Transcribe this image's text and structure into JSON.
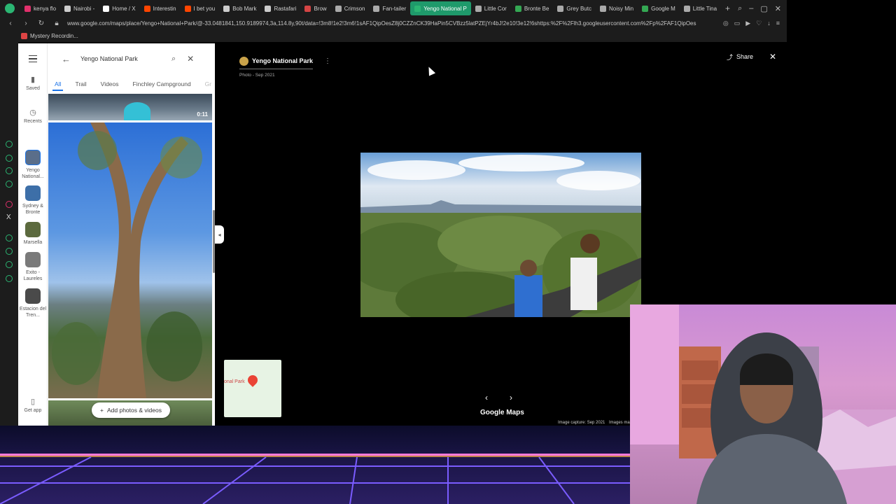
{
  "browser": {
    "tabs": [
      {
        "label": "kenya flo",
        "color": "#e1306c"
      },
      {
        "label": "Nairobi -",
        "color": "#cccccc"
      },
      {
        "label": "Home / X",
        "color": "#ffffff"
      },
      {
        "label": "Interestin",
        "color": "#ff4500"
      },
      {
        "label": "I bet you",
        "color": "#ff4500"
      },
      {
        "label": "Bob Mark",
        "color": "#cccccc"
      },
      {
        "label": "Rastafari",
        "color": "#cccccc"
      },
      {
        "label": "Brow",
        "color": "#d44444"
      },
      {
        "label": "Crimson",
        "color": "#aaaaaa"
      },
      {
        "label": "Fan-tailer",
        "color": "#aaaaaa"
      },
      {
        "label": "Yengo National P",
        "color": "#2bb673",
        "active": true
      },
      {
        "label": "Little Cor",
        "color": "#aaaaaa"
      },
      {
        "label": "Bronte Be",
        "color": "#34a853"
      },
      {
        "label": "Grey Butc",
        "color": "#aaaaaa"
      },
      {
        "label": "Noisy Min",
        "color": "#aaaaaa"
      },
      {
        "label": "Google M",
        "color": "#34a853"
      },
      {
        "label": "Little Tina",
        "color": "#aaaaaa"
      }
    ],
    "url": "www.google.com/maps/place/Yengo+National+Park/@-33.0481841,150.9189974,3a,114.8y,90t/data=!3m8!1e2!3m6!1sAF1QipOesZ8j0CZZnCK39HaPin5CVBzz5latPZEjYr4bJ!2e10!3e12!6shttps:%2F%2Flh3.googleusercontent.com%2Fp%2FAF1QipOes",
    "bookmark": "Mystery Recordin..."
  },
  "rail": {
    "saved": "Saved",
    "recents": "Recents",
    "items": [
      {
        "label": "Yengo National..."
      },
      {
        "label": "Sydney & Bronte"
      },
      {
        "label": "Marsella"
      },
      {
        "label": "Exito - Laureles"
      },
      {
        "label": "Estacion del Tren..."
      }
    ],
    "get_app": "Get app"
  },
  "panel": {
    "search_value": "Yengo National Park",
    "chips": [
      "All",
      "Trail",
      "Videos",
      "Finchley Campground",
      "Gr"
    ],
    "video_duration": "0:11",
    "add_photos": "Add photos & videos"
  },
  "viewer": {
    "place_name": "Yengo National Park",
    "photo_date": "Photo - Sep 2021",
    "share": "Share",
    "mini_map_label": "onal Park",
    "brand": "Google Maps",
    "capture": "Image capture: Sep 2021",
    "images_text": "Images ma"
  }
}
